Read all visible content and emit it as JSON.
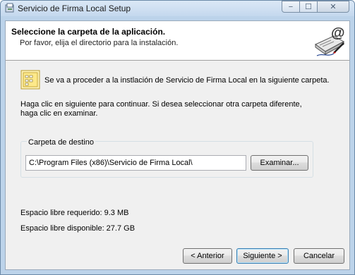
{
  "window": {
    "title": "Servicio de Firma Local Setup",
    "controls": {
      "minimize": "−",
      "maximize": "☐",
      "close": "✕"
    }
  },
  "header": {
    "title": "Seleccione la carpeta de la aplicación.",
    "subtitle": "Por favor, elija el directorio para la instalación.",
    "icon": "email-signature-icon"
  },
  "body": {
    "intro": "Se va a proceder a la instlación de Servicio de Firma Local en la siguiente carpeta.",
    "instructions_line1": "Haga clic en siguiente para continuar. Si desea seleccionar otra carpeta diferente,",
    "instructions_line2": "haga clic en examinar.",
    "folder_icon": "folder-icon"
  },
  "destination": {
    "label": "Carpeta de destino",
    "path": "C:\\Program Files (x86)\\Servicio de Firma Local\\",
    "browse_label": "Examinar..."
  },
  "space": {
    "required": "Espacio libre requerido: 9.3 MB",
    "available": "Espacio libre disponible: 27.7 GB"
  },
  "footer": {
    "back_label": "< Anterior",
    "next_label": "Siguiente >",
    "cancel_label": "Cancelar"
  }
}
